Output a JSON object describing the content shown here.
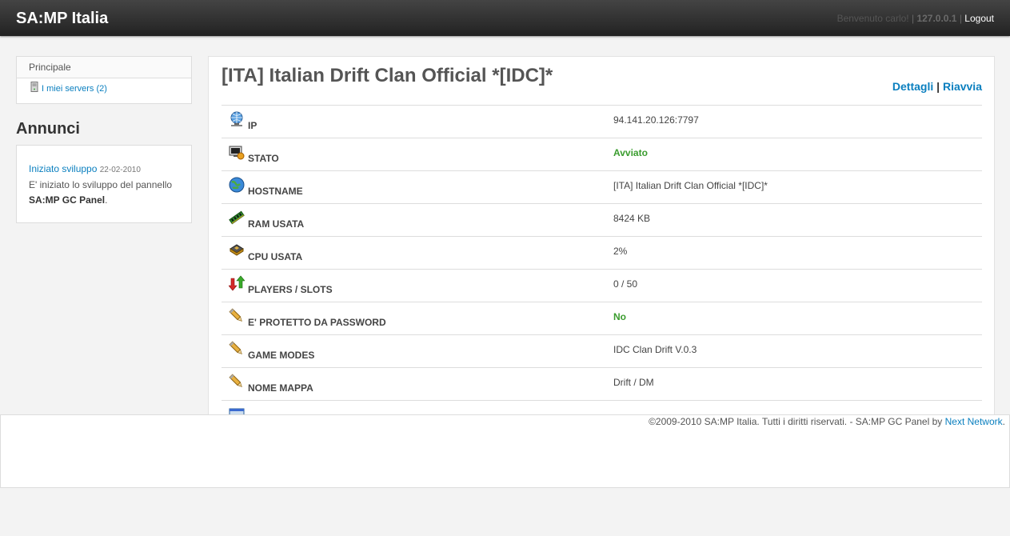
{
  "header": {
    "brand": "SA:MP Italia",
    "welcome": "Benvenuto carlo!",
    "ip": "127.0.0.1",
    "logout": "Logout"
  },
  "sidebar": {
    "menu_title": "Principale",
    "items": [
      {
        "label": "I miei servers (2)",
        "icon": "server-icon"
      }
    ],
    "annunci_title": "Annunci",
    "news": [
      {
        "title": "Iniziato sviluppo",
        "date": "22-02-2010",
        "text_before": "E' iniziato lo sviluppo del pannello",
        "text_bold": "SA:MP GC Panel",
        "text_after": "."
      }
    ]
  },
  "server": {
    "title": "[ITA] Italian Drift Clan Official *[IDC]*",
    "actions": {
      "details": "Dettagli",
      "separator": "|",
      "restart": "Riavvia"
    },
    "rows": [
      {
        "label": "IP",
        "value": "94.141.20.126:7797",
        "icon": "network-globe-icon",
        "highlight": false
      },
      {
        "label": "STATO",
        "value": "Avviato",
        "icon": "monitor-status-icon",
        "highlight": true
      },
      {
        "label": "HOSTNAME",
        "value": "[ITA] Italian Drift Clan Official *[IDC]*",
        "icon": "globe-icon",
        "highlight": false
      },
      {
        "label": "RAM USATA",
        "value": "8424 KB",
        "icon": "ram-icon",
        "highlight": false
      },
      {
        "label": "CPU USATA",
        "value": "2%",
        "icon": "cpu-icon",
        "highlight": false
      },
      {
        "label": "PLAYERS / SLOTS",
        "value": "0 / 50",
        "icon": "up-down-arrows-icon",
        "highlight": false
      },
      {
        "label": "E' PROTETTO DA PASSWORD",
        "value": "No",
        "icon": "pencil-icon",
        "highlight": true
      },
      {
        "label": "GAME MODES",
        "value": "IDC Clan Drift V.0.3",
        "icon": "pencil-icon",
        "highlight": false
      },
      {
        "label": "NOME MAPPA",
        "value": "Drift / DM",
        "icon": "pencil-icon",
        "highlight": false
      }
    ]
  },
  "footer": {
    "copyright": "©2009-2010 SA:MP Italia. Tutti i diritti riservati. - SA:MP GC Panel by",
    "link": "Next Network",
    "end": "."
  }
}
